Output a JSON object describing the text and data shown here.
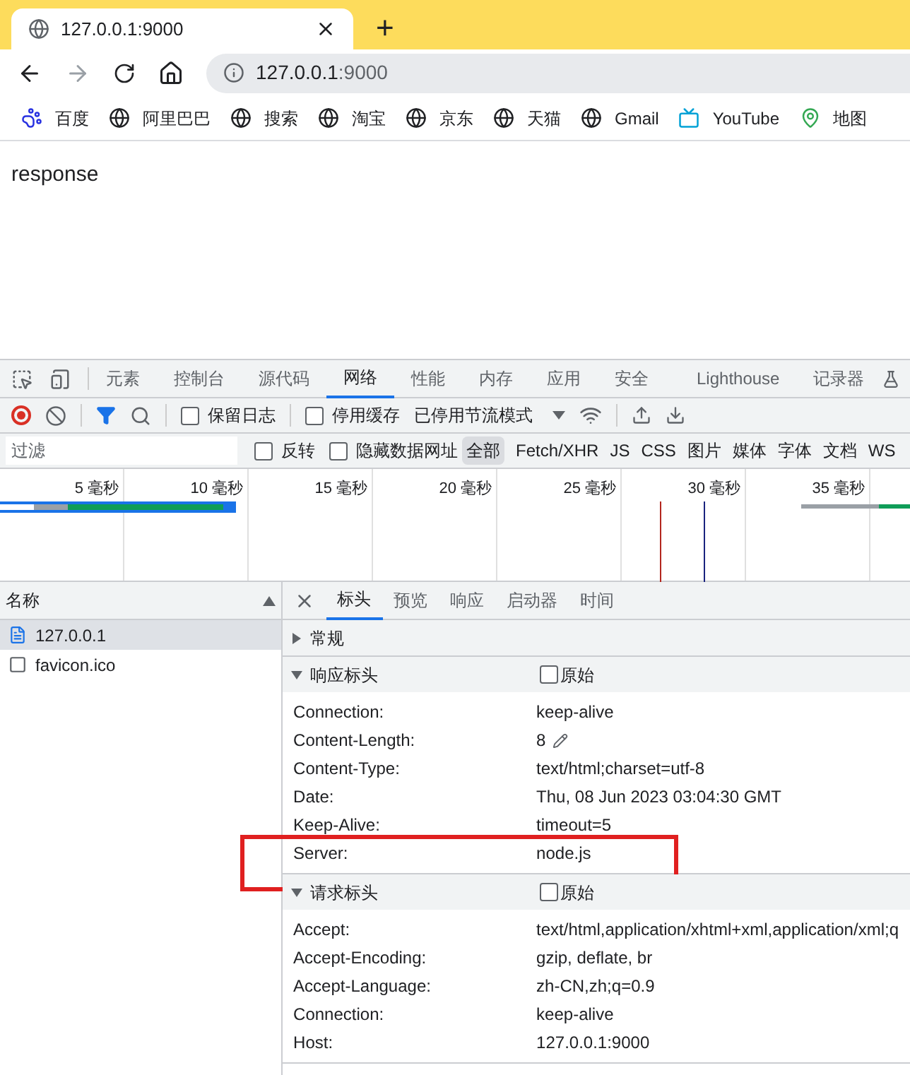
{
  "browser": {
    "tab": {
      "title": "127.0.0.1:9000"
    },
    "new_tab": "+",
    "address": {
      "host": "127.0.0.1",
      "port": ":9000"
    },
    "bookmarks": [
      {
        "label": "百度",
        "kind": "paw"
      },
      {
        "label": "阿里巴巴",
        "kind": "globe"
      },
      {
        "label": "搜索",
        "kind": "globe"
      },
      {
        "label": "淘宝",
        "kind": "globe"
      },
      {
        "label": "京东",
        "kind": "globe"
      },
      {
        "label": "天猫",
        "kind": "globe"
      },
      {
        "label": "Gmail",
        "kind": "globe"
      },
      {
        "label": "YouTube",
        "kind": "tv"
      },
      {
        "label": "地图",
        "kind": "map"
      }
    ]
  },
  "page": {
    "text": "response"
  },
  "devtools": {
    "panels": [
      {
        "label": "元素",
        "selected": false
      },
      {
        "label": "控制台",
        "selected": false
      },
      {
        "label": "源代码",
        "selected": false
      },
      {
        "label": "网络",
        "selected": true
      },
      {
        "label": "性能",
        "selected": false
      },
      {
        "label": "内存",
        "selected": false
      },
      {
        "label": "应用",
        "selected": false
      },
      {
        "label": "安全",
        "selected": false
      },
      {
        "label": "Lighthouse",
        "selected": false
      },
      {
        "label": "记录器",
        "selected": false
      }
    ],
    "toolbar": {
      "recording": true,
      "preserve_log": {
        "label": "保留日志",
        "checked": false
      },
      "disable_cache": {
        "label": "停用缓存",
        "checked": false
      },
      "throttling": "已停用节流模式"
    },
    "filter": {
      "placeholder": "过滤",
      "invert": {
        "label": "反转",
        "checked": false
      },
      "hide_data_urls": {
        "label": "隐藏数据网址",
        "checked": false
      },
      "types": [
        {
          "label": "全部",
          "selected": true
        },
        {
          "label": "Fetch/XHR",
          "selected": false
        },
        {
          "label": "JS",
          "selected": false
        },
        {
          "label": "CSS",
          "selected": false
        },
        {
          "label": "图片",
          "selected": false
        },
        {
          "label": "媒体",
          "selected": false
        },
        {
          "label": "字体",
          "selected": false
        },
        {
          "label": "文档",
          "selected": false
        },
        {
          "label": "WS",
          "selected": false
        }
      ]
    },
    "timeline": {
      "ticks": [
        "5 毫秒",
        "10 毫秒",
        "15 毫秒",
        "20 毫秒",
        "25 毫秒",
        "30 毫秒",
        "35 毫秒"
      ]
    },
    "requests": {
      "column": "名称",
      "rows": [
        {
          "name": "127.0.0.1",
          "kind": "document",
          "selected": true
        },
        {
          "name": "favicon.ico",
          "kind": "other",
          "selected": false
        }
      ]
    },
    "detail": {
      "tabs": [
        {
          "label": "标头",
          "selected": true
        },
        {
          "label": "预览",
          "selected": false
        },
        {
          "label": "响应",
          "selected": false
        },
        {
          "label": "启动器",
          "selected": false
        },
        {
          "label": "时间",
          "selected": false
        }
      ],
      "sections": [
        {
          "title": "常规",
          "expanded": false
        },
        {
          "title": "响应标头",
          "expanded": true,
          "raw": {
            "label": "原始",
            "checked": false
          },
          "headers": [
            {
              "name": "Connection:",
              "value": "keep-alive"
            },
            {
              "name": "Content-Length:",
              "value": "8",
              "editable": true
            },
            {
              "name": "Content-Type:",
              "value": "text/html;charset=utf-8"
            },
            {
              "name": "Date:",
              "value": "Thu, 08 Jun 2023 03:04:30 GMT"
            },
            {
              "name": "Keep-Alive:",
              "value": "timeout=5"
            },
            {
              "name": "Server:",
              "value": "node.js",
              "highlighted": true
            }
          ]
        },
        {
          "title": "请求标头",
          "expanded": true,
          "raw": {
            "label": "原始",
            "checked": false
          },
          "headers": [
            {
              "name": "Accept:",
              "value": "text/html,application/xhtml+xml,application/xml;q"
            },
            {
              "name": "Accept-Encoding:",
              "value": "gzip, deflate, br"
            },
            {
              "name": "Accept-Language:",
              "value": "zh-CN,zh;q=0.9"
            },
            {
              "name": "Connection:",
              "value": "keep-alive"
            },
            {
              "name": "Host:",
              "value": "127.0.0.1:9000"
            }
          ]
        }
      ]
    }
  }
}
